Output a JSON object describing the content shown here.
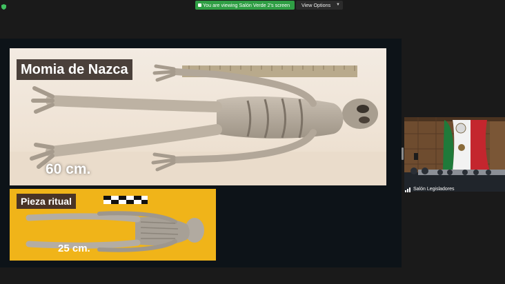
{
  "topbar": {
    "share_notice": "You are viewing Salón Verde 2's screen",
    "view_options_label": "View Options"
  },
  "slide": {
    "title": "Momia de Nazca",
    "main_size": "60 cm.",
    "ritual_label": "Pieza ritual",
    "ritual_size": "25 cm."
  },
  "participant": {
    "name": "Salón Legisladores"
  },
  "colors": {
    "share_green": "#2f9e44",
    "ritual_yellow": "#f0b419"
  },
  "icons": [
    "shield-icon",
    "chevron-down-icon",
    "signal-icon"
  ]
}
